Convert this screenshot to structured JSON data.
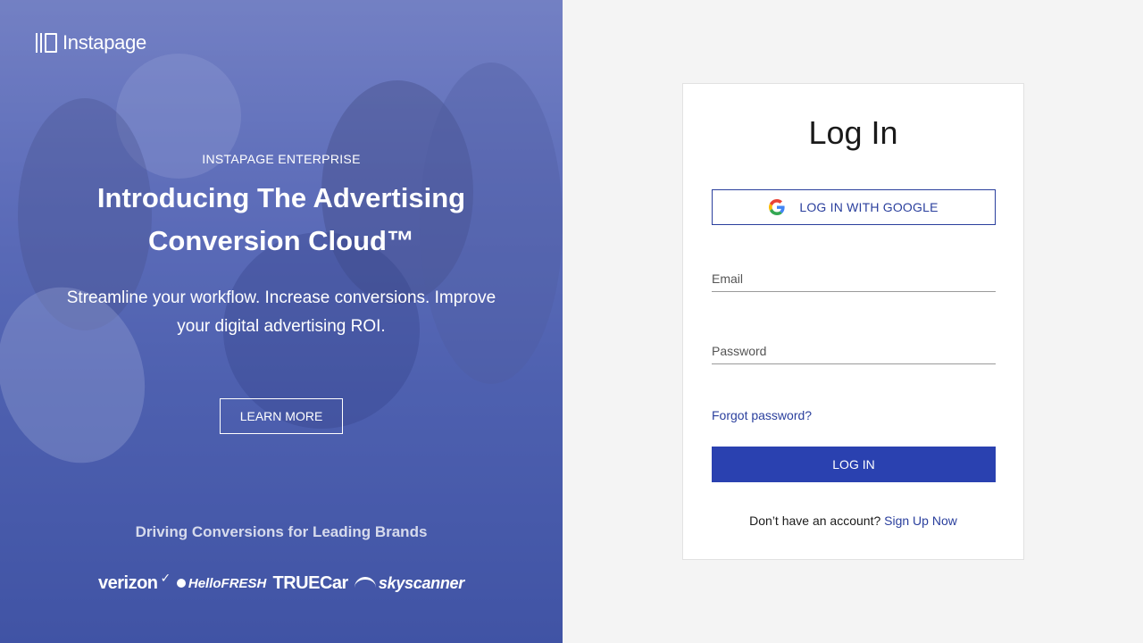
{
  "hero": {
    "logo_text": "Instapage",
    "eyebrow": "INSTAPAGE ENTERPRISE",
    "headline": "Introducing The Advertising Conversion Cloud™",
    "subhead": "Streamline your workflow. Increase conversions. Improve your digital advertising ROI.",
    "learn_more_label": "LEARN MORE",
    "brands_title": "Driving Conversions for Leading Brands",
    "brands": [
      {
        "name": "verizon",
        "icon": "checkmark-icon"
      },
      {
        "name": "HelloFRESH",
        "icon": "hellofresh-dot-icon"
      },
      {
        "name": "TRUECar",
        "icon": ""
      },
      {
        "name": "skyscanner",
        "icon": "skyscanner-sunrise-icon"
      }
    ]
  },
  "login": {
    "title": "Log In",
    "google_label": "LOG IN WITH GOOGLE",
    "email_placeholder": "Email",
    "password_placeholder": "Password",
    "forgot_label": "Forgot password?",
    "login_label": "LOG IN",
    "no_account_text": "Don’t have an account?",
    "signup_label": "Sign Up Now"
  },
  "colors": {
    "accent": "#2a41b0",
    "link": "#2a3f9d",
    "hero_overlay": "#4354aa",
    "page_bg": "#f4f4f4"
  }
}
